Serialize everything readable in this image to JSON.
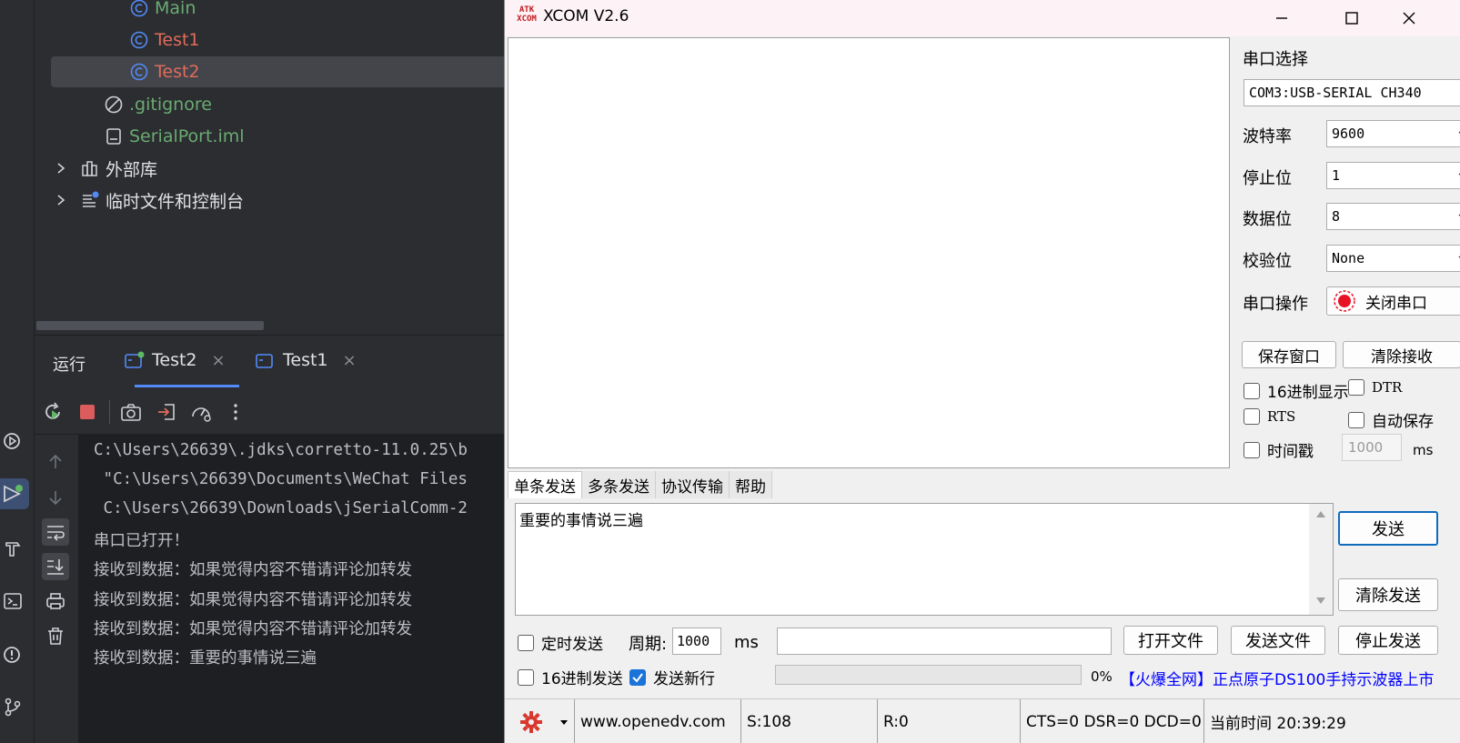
{
  "ide": {
    "tree": {
      "items": [
        {
          "label": "Main"
        },
        {
          "label": "Test1"
        },
        {
          "label": "Test2"
        },
        {
          "label": ".gitignore"
        },
        {
          "label": "SerialPort.iml"
        },
        {
          "label": "外部库"
        },
        {
          "label": "临时文件和控制台"
        }
      ]
    },
    "run": {
      "title": "运行",
      "tabs": [
        {
          "label": "Test2",
          "close": "×"
        },
        {
          "label": "Test1",
          "close": "×"
        }
      ]
    },
    "console": {
      "lines": [
        "C:\\Users\\26639\\.jdks\\corretto-11.0.25\\b",
        " \"C:\\Users\\26639\\Documents\\WeChat Files",
        " C:\\Users\\26639\\Downloads\\jSerialComm-2",
        "串口已打开！",
        "接收到数据：如果觉得内容不错请评论加转发",
        "接收到数据：如果觉得内容不错请评论加转发",
        "接收到数据：如果觉得内容不错请评论加转发",
        "接收到数据：重要的事情说三遍"
      ]
    }
  },
  "xcom": {
    "logo_top": "ATK",
    "logo_bottom": "XCOM",
    "title": "XCOM V2.6",
    "panel": {
      "port_label": "串口选择",
      "port_value": "COM3:USB-SERIAL CH340",
      "baud_label": "波特率",
      "baud_value": "9600",
      "stop_label": "停止位",
      "stop_value": "1",
      "data_label": "数据位",
      "data_value": "8",
      "parity_label": "校验位",
      "parity_value": "None",
      "op_label": "串口操作",
      "op_button": "关闭串口",
      "save_window": "保存窗口",
      "clear_recv": "清除接收",
      "hex_display": "16进制显示",
      "dtr": "DTR",
      "rts": "RTS",
      "auto_save": "自动保存",
      "timestamp": "时间戳",
      "timestamp_ms": "1000",
      "ms_unit": "ms"
    },
    "send_tabs": [
      "单条发送",
      "多条发送",
      "协议传输",
      "帮助"
    ],
    "send_text": "重要的事情说三遍",
    "send_button": "发送",
    "clear_send": "清除发送",
    "timed_send": "定时发送",
    "period_label": "周期:",
    "period_value": "1000",
    "period_unit": "ms",
    "open_file": "打开文件",
    "send_file": "发送文件",
    "stop_send": "停止发送",
    "hex_send": "16进制发送",
    "send_newline": "发送新行",
    "progress_label": "0%",
    "progress_fraction": 0,
    "ad_text": "【火爆全网】正点原子DS100手持示波器上市",
    "status": {
      "url": "www.openedv.com",
      "sent": "S:108",
      "recv": "R:0",
      "lines": "CTS=0 DSR=0 DCD=0",
      "time": "当前时间 20:39:29"
    },
    "colors": {
      "accent": "#1a73d9",
      "ad": "#0000ff",
      "record": "#e81123"
    }
  }
}
